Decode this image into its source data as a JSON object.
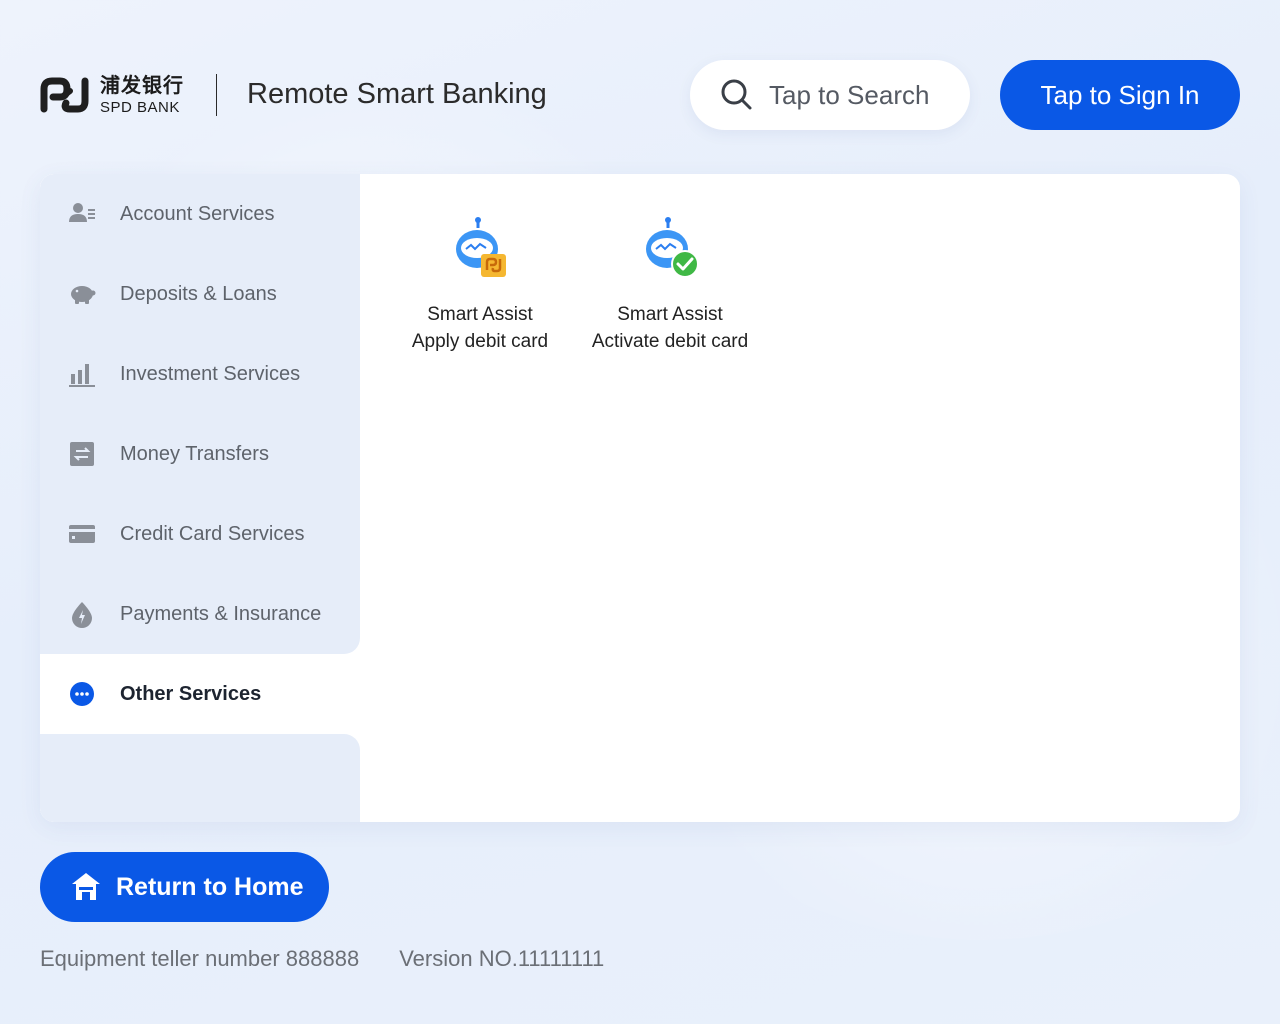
{
  "header": {
    "logo_cn": "浦发银行",
    "logo_en": "SPD BANK",
    "title": "Remote Smart Banking",
    "search_placeholder": "Tap to Search",
    "sign_in_label": "Tap to Sign In"
  },
  "sidebar": {
    "items": [
      {
        "label": "Account Services",
        "icon": "account-icon",
        "active": false
      },
      {
        "label": "Deposits & Loans",
        "icon": "piggy-bank-icon",
        "active": false
      },
      {
        "label": "Investment Services",
        "icon": "bar-chart-icon",
        "active": false
      },
      {
        "label": "Money Transfers",
        "icon": "transfer-icon",
        "active": false
      },
      {
        "label": "Credit Card Services",
        "icon": "credit-card-icon",
        "active": false
      },
      {
        "label": "Payments & Insurance",
        "icon": "payment-drop-icon",
        "active": false
      },
      {
        "label": "Other Services",
        "icon": "more-dots-icon",
        "active": true
      }
    ]
  },
  "content": {
    "tiles": [
      {
        "title": "Smart Assist",
        "subtitle": "Apply debit card",
        "icon": "robot-card-icon"
      },
      {
        "title": "Smart Assist",
        "subtitle": "Activate debit card",
        "icon": "robot-check-icon"
      }
    ]
  },
  "footer": {
    "home_label": "Return to Home",
    "teller_number": "Equipment teller number 888888",
    "version": "Version NO.11111111"
  },
  "colors": {
    "primary": "#0a58e6",
    "sidebar_bg": "#e6edf9",
    "icon_gray": "#8a8f98",
    "check_green": "#3fb845",
    "card_orange": "#f5b731"
  }
}
